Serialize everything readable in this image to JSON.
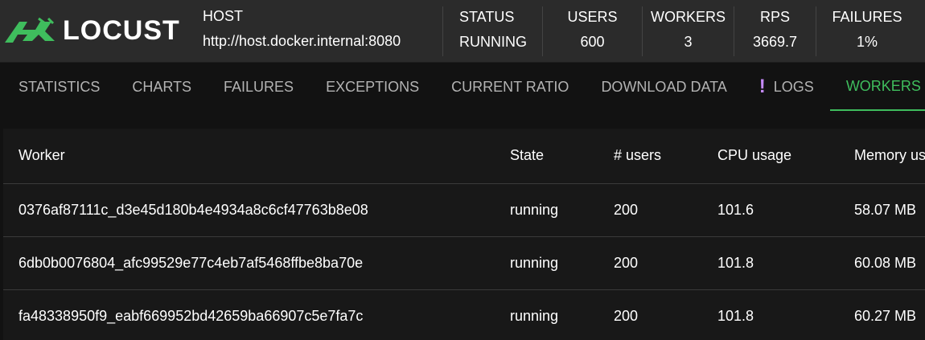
{
  "brand": {
    "name": "LOCUST",
    "logo_color": "#3fbd5d"
  },
  "header": {
    "host_label": "HOST",
    "host_value": "http://host.docker.internal:8080",
    "stats": [
      {
        "label": "STATUS",
        "value": "RUNNING"
      },
      {
        "label": "USERS",
        "value": "600"
      },
      {
        "label": "WORKERS",
        "value": "3"
      },
      {
        "label": "RPS",
        "value": "3669.7"
      },
      {
        "label": "FAILURES",
        "value": "1%"
      }
    ]
  },
  "tabs": [
    {
      "label": "STATISTICS"
    },
    {
      "label": "CHARTS"
    },
    {
      "label": "FAILURES"
    },
    {
      "label": "EXCEPTIONS"
    },
    {
      "label": "CURRENT RATIO"
    },
    {
      "label": "DOWNLOAD DATA"
    },
    {
      "label": "LOGS",
      "icon": "warning-exclamation-icon",
      "icon_glyph": "!"
    },
    {
      "label": "WORKERS",
      "active": true
    }
  ],
  "workers_table": {
    "columns": [
      "Worker",
      "State",
      "# users",
      "CPU usage",
      "Memory usage"
    ],
    "rows": [
      [
        "0376af87111c_d3e45d180b4e4934a8c6cf47763b8e08",
        "running",
        "200",
        "101.6",
        "58.07 MB"
      ],
      [
        "6db0b0076804_afc99529e77c4eb7af5468ffbe8ba70e",
        "running",
        "200",
        "101.8",
        "60.08 MB"
      ],
      [
        "fa48338950f9_eabf669952bd42659ba66907c5e7fa7c",
        "running",
        "200",
        "101.8",
        "60.27 MB"
      ]
    ]
  },
  "colors": {
    "accent": "#3fbd5d",
    "header_bg": "#2b2b2b",
    "page_bg": "#121212",
    "warning": "#c58af9"
  }
}
